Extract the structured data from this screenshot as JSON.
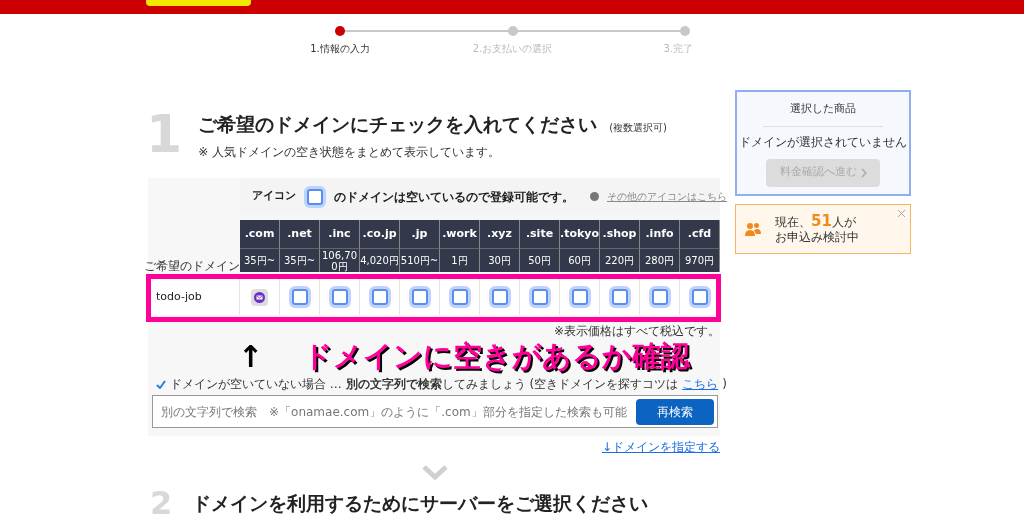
{
  "steps": [
    {
      "label": "1.情報の入力",
      "selected": true
    },
    {
      "label": "2.お支払いの選択",
      "selected": false
    },
    {
      "label": "3.完了",
      "selected": false
    }
  ],
  "section1": {
    "number": "1",
    "title": "ご希望のドメインにチェックを入れてください",
    "title_note": "(複数選択可)",
    "subtitle": "※ 人気ドメインの空き状態をまとめて表示しています。"
  },
  "legend": {
    "prefix": "アイコン",
    "suffix": "のドメインは空いているので登録可能です。",
    "link": "その他のアイコンはこちら"
  },
  "table": {
    "row_label": "ご希望のドメイン",
    "columns": [
      {
        "tld": ".com",
        "price": "35円~"
      },
      {
        "tld": ".net",
        "price": "35円~"
      },
      {
        "tld": ".inc",
        "price": "106,700円"
      },
      {
        "tld": ".co.jp",
        "price": "4,020円"
      },
      {
        "tld": ".jp",
        "price": "510円~"
      },
      {
        "tld": ".work",
        "price": "1円"
      },
      {
        "tld": ".xyz",
        "price": "30円"
      },
      {
        "tld": ".site",
        "price": "50円"
      },
      {
        "tld": ".tokyo",
        "price": "60円"
      },
      {
        "tld": ".shop",
        "price": "220円"
      },
      {
        "tld": ".info",
        "price": "280円"
      },
      {
        "tld": ".cfd",
        "price": "970円"
      }
    ],
    "rows": [
      {
        "domain": "todo-job",
        "cells": [
          {
            "kind": "taken"
          },
          {
            "kind": "available",
            "checked": false
          },
          {
            "kind": "available",
            "checked": false
          },
          {
            "kind": "available",
            "checked": false
          },
          {
            "kind": "available",
            "checked": false
          },
          {
            "kind": "available",
            "checked": false
          },
          {
            "kind": "available",
            "checked": false
          },
          {
            "kind": "available",
            "checked": false
          },
          {
            "kind": "available",
            "checked": false
          },
          {
            "kind": "available",
            "checked": false
          },
          {
            "kind": "available",
            "checked": false
          },
          {
            "kind": "available",
            "checked": false
          }
        ]
      }
    ],
    "tax_note": "※表示価格はすべて税込です。"
  },
  "annotation": {
    "arrow": "↑",
    "text": "ドメインに空きがあるか確認"
  },
  "hint": {
    "text": "ドメインが空いていない場合 … **別の文字列で検索**してみましょう (空きドメインを探すコツは",
    "link": "こちら",
    "close": ")"
  },
  "search": {
    "placeholder": "別の文字列で検索　※「onamae.com」のように「.com」部分を指定した検索も可能",
    "button": "再検索"
  },
  "specify_link": "↓ドメインを指定する",
  "section2": {
    "number": "2",
    "title": "ドメインを利用するためにサーバーをご選択ください"
  },
  "cart": {
    "title": "選択した商品",
    "empty": "ドメインが選択されていません",
    "button": "料金確認へ進む",
    "disabled": true
  },
  "notice": {
    "prefix": "現在、",
    "count": "51",
    "suffix": "人が",
    "line2": "お申込み検討中"
  }
}
